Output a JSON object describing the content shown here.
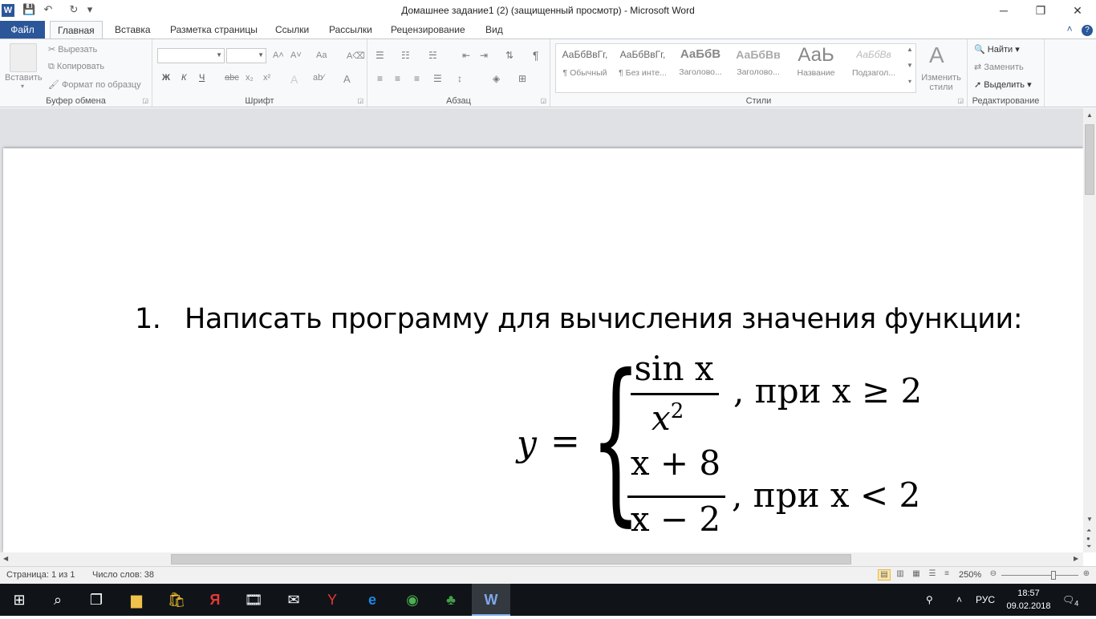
{
  "window": {
    "title": "Домашнее задание1 (2) (защищенный просмотр)  -  Microsoft Word",
    "app_icon": "W",
    "controls": {
      "minimize": "─",
      "restore": "❐",
      "close": "✕"
    }
  },
  "quick_access": {
    "save_icon": "💾",
    "undo_icon": "↶",
    "redo_icon": "↻",
    "customize_icon": "▾"
  },
  "tabs": {
    "file": "Файл",
    "items": [
      "Главная",
      "Вставка",
      "Разметка страницы",
      "Ссылки",
      "Рассылки",
      "Рецензирование",
      "Вид"
    ],
    "active_index": 0
  },
  "ribbon": {
    "clipboard": {
      "label": "Буфер обмена",
      "paste": "Вставить",
      "cut": "Вырезать",
      "copy": "Копировать",
      "format_painter": "Формат по образцу"
    },
    "font": {
      "label": "Шрифт",
      "font_name": "",
      "font_size": "",
      "grow": "A˄",
      "shrink": "A˅",
      "case": "Aa",
      "clear": "A⌫",
      "bold": "Ж",
      "italic": "К",
      "underline": "Ч",
      "strike": "abc",
      "subscript": "x₂",
      "superscript": "x²",
      "text_effects": "A",
      "highlight": "ab⁄",
      "font_color": "A"
    },
    "paragraph": {
      "label": "Абзац"
    },
    "styles": {
      "label": "Стили",
      "items": [
        {
          "preview": "АаБбВвГг,",
          "name": "¶ Обычный"
        },
        {
          "preview": "АаБбВвГг,",
          "name": "¶ Без инте..."
        },
        {
          "preview": "АаБбВ",
          "name": "Заголово..."
        },
        {
          "preview": "АаБбВв",
          "name": "Заголово..."
        },
        {
          "preview": "АаЬ",
          "name": "Название"
        },
        {
          "preview": "АаБбВв",
          "name": "Подзагол..."
        }
      ],
      "change": "Изменить стили"
    },
    "editing": {
      "label": "Редактирование",
      "find": "Найти",
      "replace": "Заменить",
      "select": "Выделить"
    }
  },
  "document": {
    "item_number": "1.",
    "item_text": "Написать программу для вычисления значения функции:",
    "formula": {
      "lhs": "y",
      "eq": "=",
      "case1": {
        "num": "sin x",
        "den": "x",
        "den_exp": "2",
        "cond": ", при x ≥ 2"
      },
      "case2": {
        "num": "x + 8",
        "den": "x − 2",
        "cond": ", при x < 2"
      }
    }
  },
  "status": {
    "page": "Страница: 1 из 1",
    "words": "Число слов: 38",
    "zoom": "250%"
  },
  "taskbar": {
    "lang": "РУС",
    "time": "18:57",
    "date": "09.02.2018",
    "notifications": "4"
  }
}
